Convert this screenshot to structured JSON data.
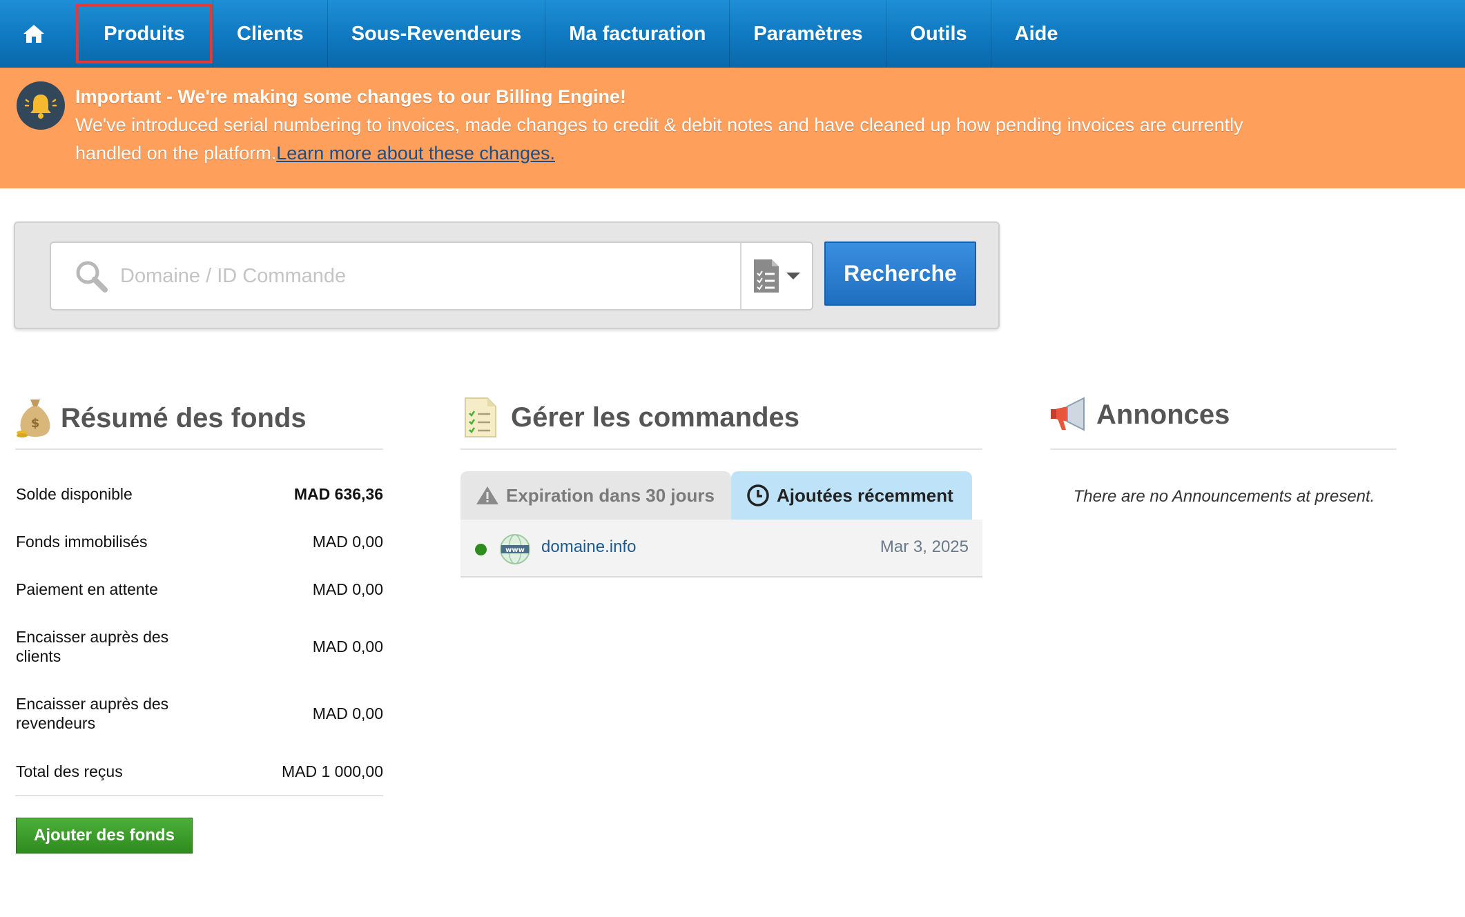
{
  "nav": {
    "items": [
      {
        "label": "Produits"
      },
      {
        "label": "Clients"
      },
      {
        "label": "Sous-Revendeurs"
      },
      {
        "label": "Ma facturation"
      },
      {
        "label": "Paramètres"
      },
      {
        "label": "Outils"
      },
      {
        "label": "Aide"
      }
    ]
  },
  "banner": {
    "title": "Important - We're making some changes to our Billing Engine!",
    "text": "We've introduced serial numbering to invoices, made changes to credit & debit notes and have cleaned up how pending invoices are currently handled on the platform.",
    "link": "Learn more about these changes."
  },
  "search": {
    "placeholder": "Domaine / ID Commande",
    "button": "Recherche"
  },
  "funds": {
    "title": "Résumé des fonds",
    "rows": [
      {
        "label": "Solde disponible",
        "value": "MAD 636,36"
      },
      {
        "label": "Fonds immobilisés",
        "value": "MAD 0,00"
      },
      {
        "label": "Paiement en attente",
        "value": "MAD 0,00"
      },
      {
        "label": "Encaisser auprès des clients",
        "value": "MAD 0,00"
      },
      {
        "label": "Encaisser auprès des revendeurs",
        "value": "MAD 0,00"
      },
      {
        "label": "Total des reçus",
        "value": "MAD 1 000,00"
      }
    ],
    "button": "Ajouter des fonds"
  },
  "orders": {
    "title": "Gérer les commandes",
    "tabs": [
      {
        "label": "Expiration dans 30 jours"
      },
      {
        "label": "Ajoutées récemment"
      }
    ],
    "rows": [
      {
        "domain": "domaine.info",
        "date": "Mar 3, 2025",
        "status_color": "#2e8b1e"
      }
    ]
  },
  "announcements": {
    "title": "Annonces",
    "empty": "There are no Announcements at present."
  },
  "colors": {
    "nav": "#0f78c0",
    "banner": "#ff9f5c",
    "primary_button": "#1f6fc0",
    "success_button": "#2e8b1e",
    "highlight": "#e53935"
  }
}
